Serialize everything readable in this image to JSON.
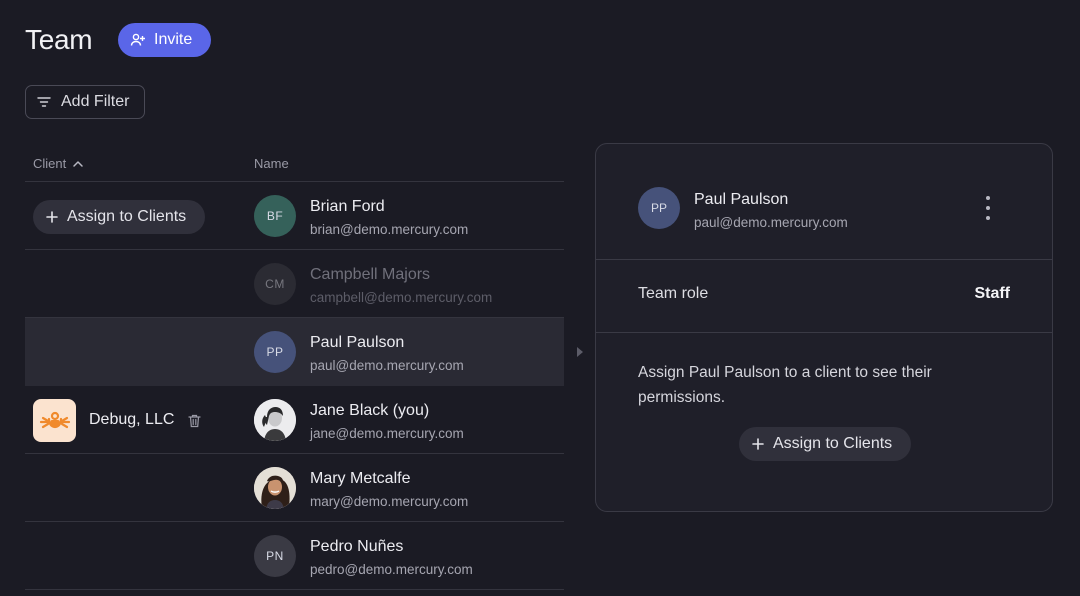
{
  "header": {
    "title": "Team",
    "invite_label": "Invite",
    "filter_label": "Add Filter"
  },
  "table": {
    "columns": {
      "client": "Client",
      "name": "Name"
    },
    "rows": [
      {
        "initials": "BF",
        "name": "Brian Ford",
        "email": "brian@demo.mercury.com",
        "avatar_color": "#35615a"
      },
      {
        "initials": "CM",
        "name": "Campbell Majors",
        "email": "campbell@demo.mercury.com",
        "avatar_color": "#2b2b33"
      },
      {
        "initials": "PP",
        "name": "Paul Paulson",
        "email": "paul@demo.mercury.com",
        "avatar_color": "#46527a"
      },
      {
        "initials": "",
        "name": "Jane Black (you)",
        "email": "jane@demo.mercury.com"
      },
      {
        "initials": "",
        "name": "Mary Metcalfe",
        "email": "mary@demo.mercury.com"
      },
      {
        "initials": "PN",
        "name": "Pedro Nuñes",
        "email": "pedro@demo.mercury.com",
        "avatar_color": "#3a3a44"
      }
    ],
    "assign_label": "Assign to Clients",
    "client_name": "Debug, LLC"
  },
  "panel": {
    "initials": "PP",
    "name": "Paul Paulson",
    "email": "paul@demo.mercury.com",
    "role_label": "Team role",
    "role_value": "Staff",
    "message": "Assign Paul Paulson to a client to see their permissions.",
    "assign_label": "Assign to Clients"
  },
  "colors": {
    "background": "#1b1b24",
    "accent": "#5a66e8",
    "client_logo_bg": "#fbe3cf",
    "client_logo_fg": "#f08a2c"
  }
}
